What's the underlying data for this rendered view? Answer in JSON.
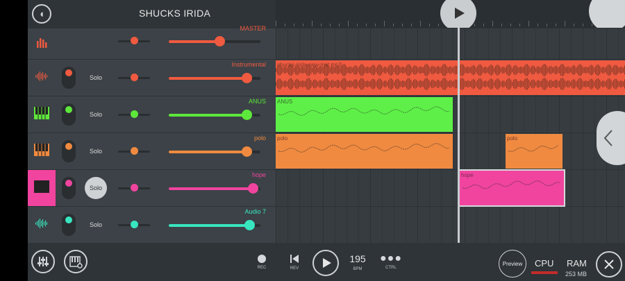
{
  "app": {
    "title": "SHUCKS IRIDA",
    "logo_icon": "fl-studio-logo-icon"
  },
  "timeline": {
    "position_marker": "161"
  },
  "tracks": [
    {
      "name": "MASTER",
      "color": "#f05a40",
      "icon": "equalizer-icon",
      "solo": null,
      "volume": 0.55,
      "pan": 0.5
    },
    {
      "name": "Instrumental",
      "color": "#f05a40",
      "icon": "waveform-icon",
      "solo": "Solo",
      "solo_active": false,
      "volume": 0.85,
      "pan": 0.5
    },
    {
      "name": "ANUS",
      "color": "#5ee83c",
      "icon": "piano-icon",
      "solo": "Solo",
      "solo_active": false,
      "volume": 0.85,
      "pan": 0.5
    },
    {
      "name": "polo",
      "color": "#f08a40",
      "icon": "piano-icon",
      "solo": "Solo",
      "solo_active": false,
      "volume": 0.85,
      "pan": 0.5
    },
    {
      "name": "hope",
      "color": "#f0449e",
      "icon": "piano-icon",
      "solo": "Solo",
      "solo_active": true,
      "volume": 0.92,
      "pan": 0.5
    },
    {
      "name": "Audio 7",
      "color": "#38e6c0",
      "icon": "waveform-icon",
      "solo": "Solo",
      "solo_active": false,
      "volume": 0.88,
      "pan": 0.5
    }
  ],
  "clips": [
    {
      "label": "shucks-irida-new-inst.mp3",
      "lane": 1,
      "color": "#f05a40"
    },
    {
      "label": "ANUS",
      "lane": 2,
      "color": "#5ef048"
    },
    {
      "label": "polo",
      "lane": 3,
      "color": "#f08a40"
    },
    {
      "label": "polo",
      "lane": 3,
      "color": "#f08a40"
    },
    {
      "label": "hope",
      "lane": 4,
      "color": "#f0449e"
    }
  ],
  "bottom": {
    "mixer_icon": "mixer-sliders-icon",
    "piano_settings_icon": "piano-settings-icon",
    "rec_label": "REC",
    "rev_label": "REV",
    "bpm_value": "195",
    "bpm_label": "BPM",
    "ctrl_label": "CTRL",
    "preview_label": "Preview",
    "cpu_label": "CPU",
    "ram_label": "RAM",
    "ram_value": "253 MB",
    "cpu_bar_color": "#c32b2b"
  }
}
